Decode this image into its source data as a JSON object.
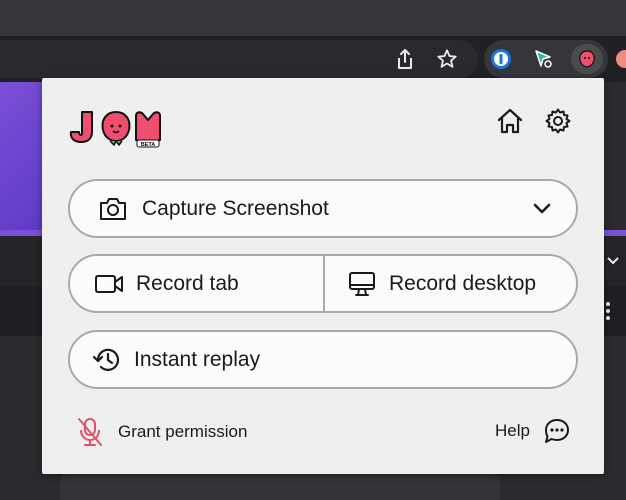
{
  "popup": {
    "capture_label": "Capture Screenshot",
    "record_tab_label": "Record tab",
    "record_desktop_label": "Record desktop",
    "instant_replay_label": "Instant replay",
    "grant_permission_label": "Grant permission",
    "help_label": "Help"
  },
  "logo": {
    "text": "JAM",
    "badge": "BETA"
  },
  "colors": {
    "brand_pink": "#ee4f6f",
    "popup_bg": "#efefef",
    "button_border": "#a9a9a9",
    "mic_red": "#e0506a"
  },
  "icons": {
    "toolbar": [
      "share-icon",
      "star-icon",
      "onepassword-icon",
      "extension-icon",
      "jam-extension-icon"
    ],
    "header": [
      "home-icon",
      "gear-icon"
    ],
    "buttons": [
      "camera-icon",
      "chevron-down-icon",
      "video-camera-icon",
      "monitor-icon",
      "history-icon"
    ],
    "footer": [
      "mic-off-icon",
      "chat-bubble-icon"
    ]
  }
}
